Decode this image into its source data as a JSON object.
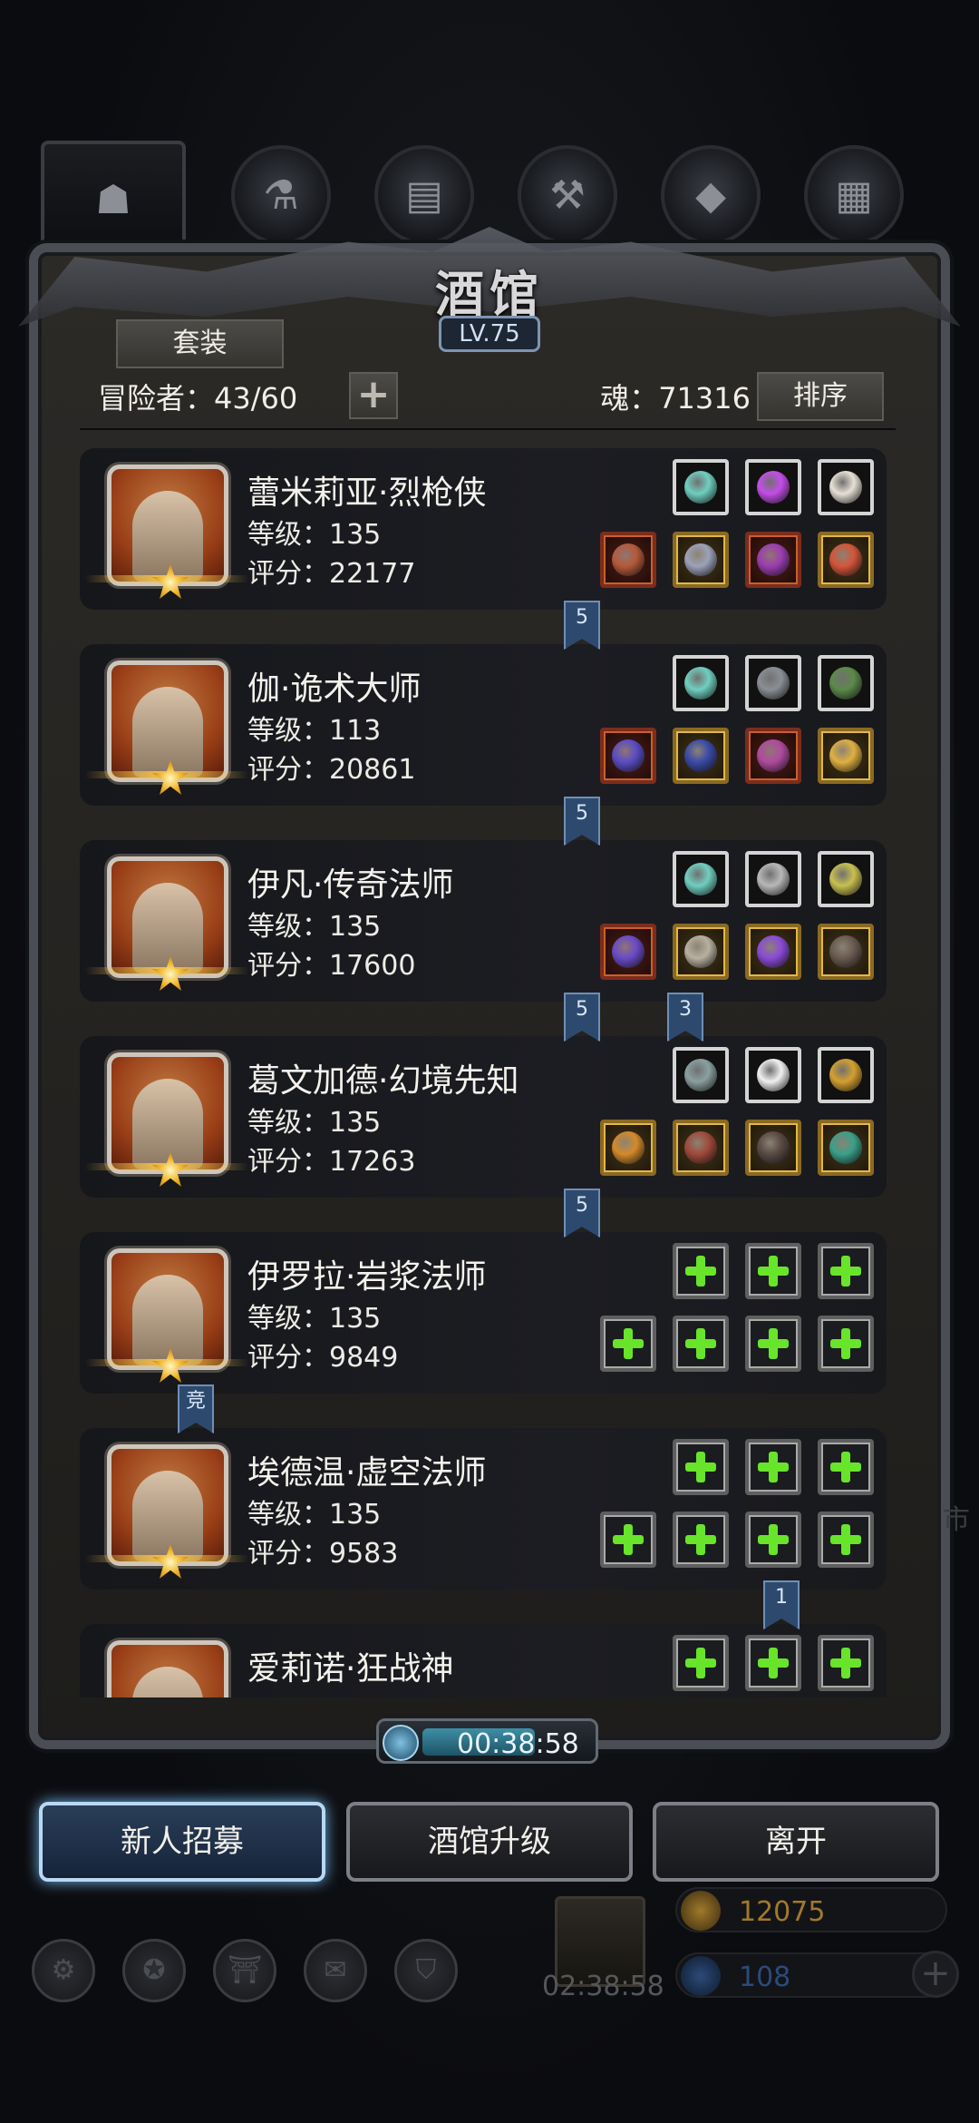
{
  "panel": {
    "title": "酒馆",
    "level": "LV.75",
    "set_label": "套装",
    "adventurers_text": "冒险者：43/60",
    "add_label": "+",
    "soul_text": "魂：71316",
    "sort_label": "排序"
  },
  "heroes": [
    {
      "name": "蕾米莉亚·烈枪侠",
      "level": "等级：135",
      "score": "评分：22177",
      "portrait_color": "#9a3f18",
      "top_slots": [
        {
          "type": "normal",
          "icon": "rune-icon",
          "color": "#6fcfc0"
        },
        {
          "type": "normal",
          "icon": "purple-gem-icon",
          "color": "#c44de8"
        },
        {
          "type": "normal",
          "icon": "horn-icon",
          "color": "#e6e1d6"
        }
      ],
      "bottom_slots": [
        {
          "type": "red",
          "icon": "spear-icon",
          "color": "#b55a3a"
        },
        {
          "type": "gold",
          "icon": "armor-icon",
          "color": "#9ca2b8"
        },
        {
          "type": "red",
          "icon": "amulet-icon",
          "color": "#9c3db0"
        },
        {
          "type": "gold",
          "icon": "ring-icon",
          "color": "#d4553a"
        }
      ],
      "flags": [
        {
          "text": "5"
        }
      ]
    },
    {
      "name": "伽·诡术大师",
      "level": "等级：113",
      "score": "评分：20861",
      "portrait_color": "#9a3f18",
      "top_slots": [
        {
          "type": "normal",
          "icon": "rune-icon",
          "color": "#6fcfc0"
        },
        {
          "type": "normal",
          "icon": "dagger-icon",
          "color": "#8a8f96"
        },
        {
          "type": "normal",
          "icon": "tree-icon",
          "color": "#5c8a4a"
        }
      ],
      "bottom_slots": [
        {
          "type": "red",
          "icon": "sword-icon",
          "color": "#5a4cc4"
        },
        {
          "type": "gold",
          "icon": "robe-icon",
          "color": "#3a4aa8"
        },
        {
          "type": "red",
          "icon": "necklace-icon",
          "color": "#b04aa0"
        },
        {
          "type": "gold",
          "icon": "ring-icon",
          "color": "#e0b040"
        }
      ],
      "flags": [
        {
          "text": "5"
        }
      ]
    },
    {
      "name": "伊凡·传奇法师",
      "level": "等级：135",
      "score": "评分：17600",
      "portrait_color": "#9a3f18",
      "top_slots": [
        {
          "type": "normal",
          "icon": "rune-icon",
          "color": "#6fcfc0"
        },
        {
          "type": "normal",
          "icon": "feather-icon",
          "color": "#b8b8b8"
        },
        {
          "type": "normal",
          "icon": "lantern-icon",
          "color": "#c8c050"
        }
      ],
      "bottom_slots": [
        {
          "type": "red",
          "icon": "staff-icon",
          "color": "#6a4ac8"
        },
        {
          "type": "gold",
          "icon": "armor-icon",
          "color": "#b8b0a0"
        },
        {
          "type": "gold",
          "icon": "bracelet-icon",
          "color": "#8a4ad8"
        },
        {
          "type": "gold",
          "icon": "cloak-icon",
          "color": "#6a5a50"
        }
      ],
      "flags": [
        {
          "text": "5"
        },
        {
          "text": "3"
        }
      ]
    },
    {
      "name": "葛文加德·幻境先知",
      "level": "等级：135",
      "score": "评分：17263",
      "portrait_color": "#9a3f18",
      "top_slots": [
        {
          "type": "normal",
          "icon": "stone-icon",
          "color": "#8aa0a0"
        },
        {
          "type": "normal",
          "icon": "feather-icon",
          "color": "#f0f0f0"
        },
        {
          "type": "normal",
          "icon": "trophy-icon",
          "color": "#d4a030"
        }
      ],
      "bottom_slots": [
        {
          "type": "gold",
          "icon": "staff-icon",
          "color": "#d48a2a"
        },
        {
          "type": "gold",
          "icon": "armor-icon",
          "color": "#a04a3a"
        },
        {
          "type": "gold",
          "icon": "cloak-icon",
          "color": "#5a4a44"
        },
        {
          "type": "gold",
          "icon": "gem-icon",
          "color": "#3aa08a"
        }
      ],
      "flags": [
        {
          "text": "5"
        }
      ]
    },
    {
      "name": "伊罗拉·岩浆法师",
      "level": "等级：135",
      "score": "评分：9849",
      "portrait_color": "#9a3f18",
      "top_slots": [
        {
          "type": "empty",
          "icon": "add-icon",
          "color": "#68e42a"
        },
        {
          "type": "empty",
          "icon": "add-icon",
          "color": "#68e42a"
        },
        {
          "type": "empty",
          "icon": "add-icon",
          "color": "#68e42a"
        }
      ],
      "bottom_slots": [
        {
          "type": "empty",
          "icon": "add-icon",
          "color": "#68e42a"
        },
        {
          "type": "empty",
          "icon": "add-icon",
          "color": "#68e42a"
        },
        {
          "type": "empty",
          "icon": "add-icon",
          "color": "#68e42a"
        },
        {
          "type": "empty",
          "icon": "add-icon",
          "color": "#68e42a"
        }
      ],
      "flags": [
        {
          "text": "竞"
        }
      ]
    },
    {
      "name": "埃德温·虚空法师",
      "level": "等级：135",
      "score": "评分：9583",
      "portrait_color": "#9a3f18",
      "top_slots": [
        {
          "type": "empty",
          "icon": "add-icon",
          "color": "#68e42a"
        },
        {
          "type": "empty",
          "icon": "add-icon",
          "color": "#68e42a"
        },
        {
          "type": "empty",
          "icon": "add-icon",
          "color": "#68e42a"
        }
      ],
      "bottom_slots": [
        {
          "type": "empty",
          "icon": "add-icon",
          "color": "#68e42a"
        },
        {
          "type": "empty",
          "icon": "add-icon",
          "color": "#68e42a"
        },
        {
          "type": "empty",
          "icon": "add-icon",
          "color": "#68e42a"
        },
        {
          "type": "empty",
          "icon": "add-icon",
          "color": "#68e42a"
        }
      ],
      "flags": [
        {
          "text": "1"
        }
      ]
    },
    {
      "name": "爱莉诺·狂战神",
      "level": "",
      "score": "",
      "portrait_color": "#9a3f18",
      "top_slots": [
        {
          "type": "empty",
          "icon": "add-icon",
          "color": "#68e42a"
        },
        {
          "type": "empty",
          "icon": "add-icon",
          "color": "#68e42a"
        },
        {
          "type": "empty",
          "icon": "add-icon",
          "color": "#68e42a"
        }
      ],
      "bottom_slots": [],
      "flags": []
    }
  ],
  "timer": {
    "text": "00:38:58",
    "progress": 0.65
  },
  "buttons": {
    "recruit": "新人招募",
    "upgrade": "酒馆升级",
    "leave": "离开"
  },
  "background_hud": {
    "chest_timer": "02:38:58",
    "gold": "12075",
    "gems": "108",
    "gold_color": "#a07a2a",
    "gem_color": "#2c4a7a",
    "side_text": "市"
  },
  "top_tabs": [
    {
      "icon": "tavern-icon"
    },
    {
      "icon": "potion-icon"
    },
    {
      "icon": "scroll-icon"
    },
    {
      "icon": "anvil-icon"
    },
    {
      "icon": "crystal-icon"
    },
    {
      "icon": "forge-icon"
    }
  ]
}
